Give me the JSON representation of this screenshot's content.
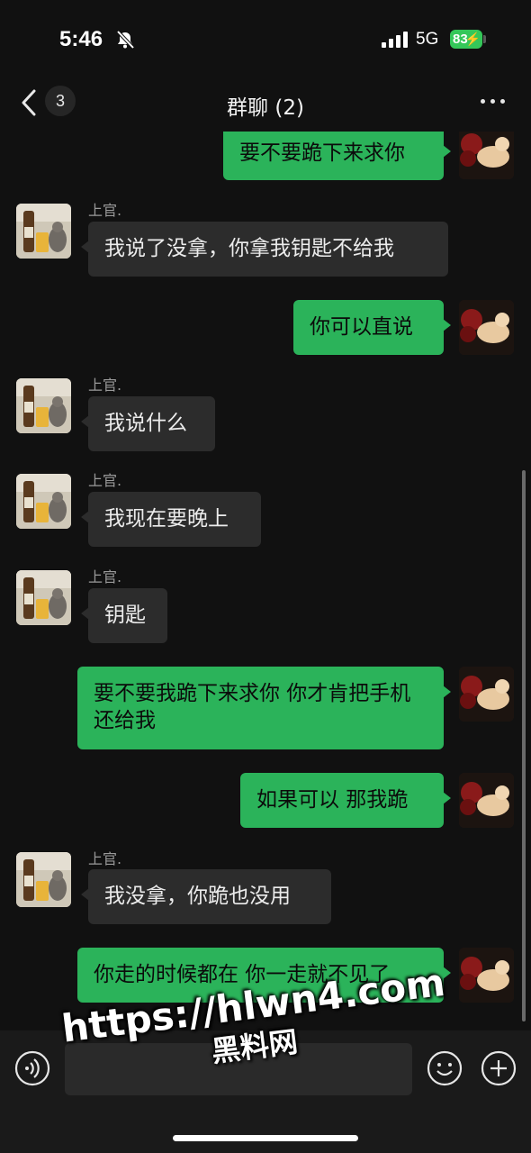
{
  "status_bar": {
    "time": "5:46",
    "network": "5G",
    "battery": "83"
  },
  "nav": {
    "back_badge": "3",
    "title": "群聊 (2)"
  },
  "messages": [
    {
      "side": "out",
      "text": "要不要跪下来求你"
    },
    {
      "side": "in",
      "sender": "上官.",
      "text": "我说了没拿，你拿我钥匙不给我"
    },
    {
      "side": "out",
      "text": "你可以直说"
    },
    {
      "side": "in",
      "sender": "上官.",
      "text": "我说什么"
    },
    {
      "side": "in",
      "sender": "上官.",
      "text": "我现在要晚上"
    },
    {
      "side": "in",
      "sender": "上官.",
      "text": "钥匙"
    },
    {
      "side": "out",
      "text": "要不要我跪下来求你 你才肯把手机还给我"
    },
    {
      "side": "out",
      "text": "如果可以 那我跪"
    },
    {
      "side": "in",
      "sender": "上官.",
      "text": "我没拿，你跪也没用"
    },
    {
      "side": "out",
      "text": "你走的时候都在 你一走就不见了"
    }
  ],
  "watermark": {
    "url": "https://hlwn4.com",
    "name": "黑料网"
  },
  "colors": {
    "background": "#111111",
    "outgoing_bubble": "#2bb35a",
    "incoming_bubble": "#2c2c2c",
    "battery": "#34c759"
  },
  "icons": [
    "bell-slash-icon",
    "signal-icon",
    "battery-icon",
    "back-chevron-icon",
    "more-icon",
    "voice-icon",
    "emoji-icon",
    "plus-icon"
  ]
}
